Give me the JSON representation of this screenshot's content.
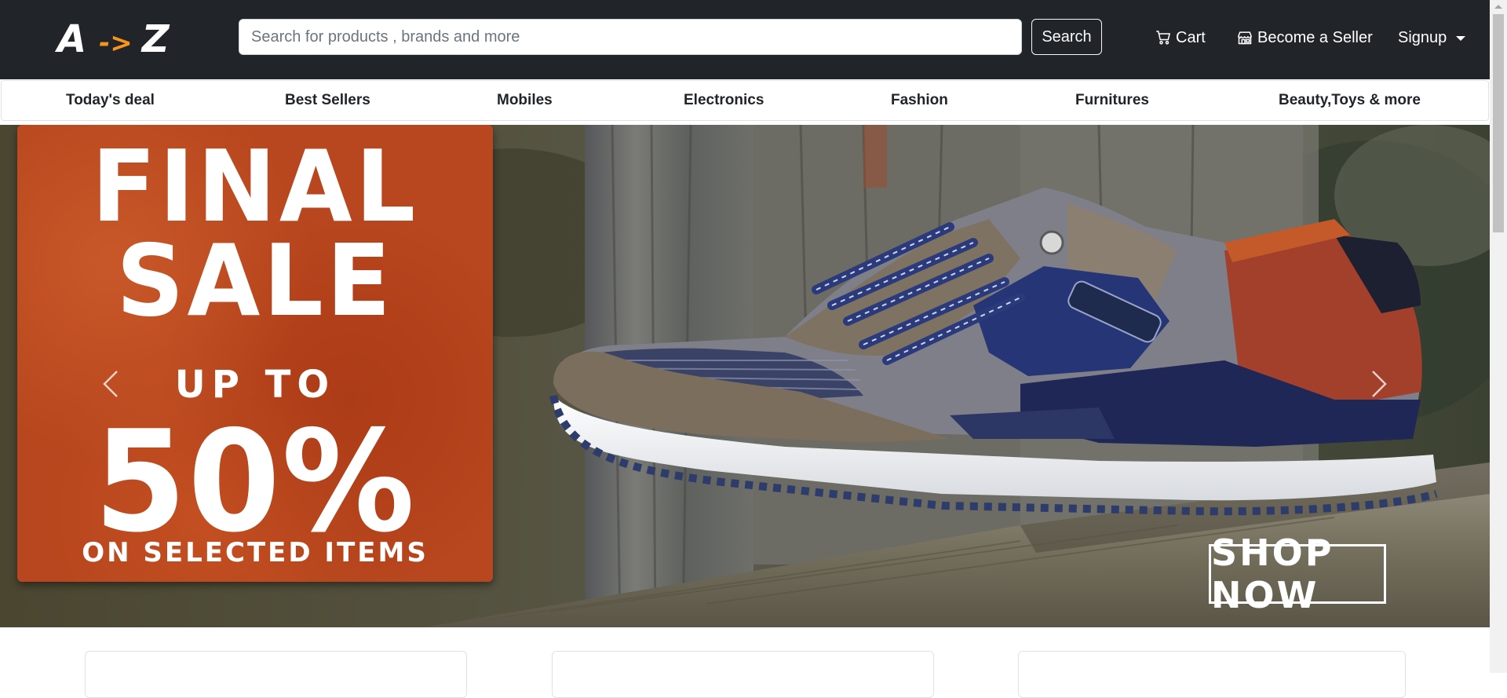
{
  "header": {
    "logo": {
      "left": "A",
      "arrow": "->",
      "right": "Z"
    },
    "search": {
      "placeholder": "Search for products , brands and more",
      "value": "",
      "button_label": "Search"
    },
    "links": {
      "cart": "Cart",
      "seller": "Become a Seller",
      "signup": "Signup"
    },
    "colors": {
      "navbar_bg": "#212529",
      "logo_arrow": "#f7941d"
    }
  },
  "categories": [
    "Today's deal",
    "Best Sellers",
    "Mobiles",
    "Electronics",
    "Fashion",
    "Furnitures",
    "Beauty,Toys & more"
  ],
  "hero": {
    "promo": {
      "line1": "FINAL",
      "line2": "SALE",
      "line3": "UP TO",
      "line4": "50%",
      "line5": "ON SELECTED ITEMS",
      "bg_color": "#b8461e"
    },
    "cta": "SHOP NOW",
    "controls": {
      "prev_icon": "chevron-left-icon",
      "next_icon": "chevron-right-icon"
    }
  }
}
